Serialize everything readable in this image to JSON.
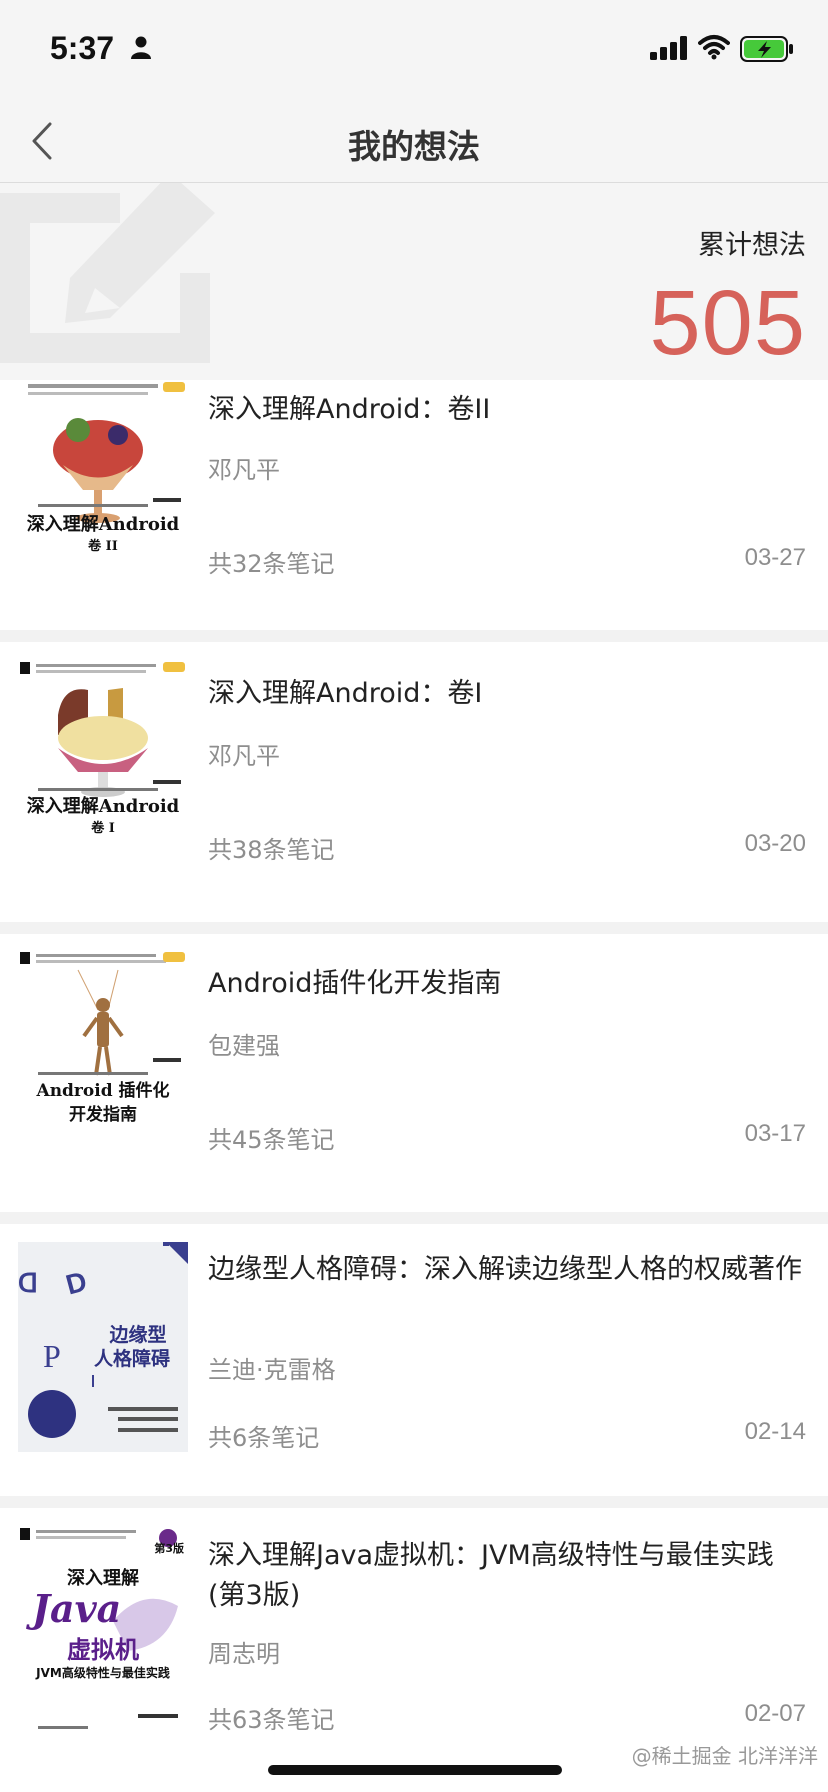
{
  "status_bar": {
    "time": "5:37"
  },
  "nav": {
    "title": "我的想法"
  },
  "summary": {
    "label": "累计想法",
    "count": "505"
  },
  "books": [
    {
      "title": "深入理解Android：卷II",
      "author": "邓凡平",
      "notes": "共32条笔记",
      "date": "03-27",
      "cover_title": "深入理解Android",
      "cover_subtitle": "卷 II"
    },
    {
      "title": "深入理解Android：卷I",
      "author": "邓凡平",
      "notes": "共38条笔记",
      "date": "03-20",
      "cover_title": "深入理解Android",
      "cover_subtitle": "卷 I"
    },
    {
      "title": "Android插件化开发指南",
      "author": "包建强",
      "notes": "共45条笔记",
      "date": "03-17",
      "cover_title": "Android 插件化",
      "cover_subtitle": "开发指南"
    },
    {
      "title": "边缘型人格障碍：深入解读边缘型人格的权威著作",
      "author": "兰迪·克雷格",
      "notes": "共6条笔记",
      "date": "02-14",
      "cover_title": "边缘型",
      "cover_subtitle": "人格障碍"
    },
    {
      "title": "深入理解Java虚拟机：JVM高级特性与最佳实践(第3版)",
      "author": "周志明",
      "notes": "共63条笔记",
      "date": "02-07",
      "cover_title": "深入理解",
      "cover_subtitle": "虚拟机",
      "cover_lang": "Java",
      "cover_tagline": "JVM高级特性与最佳实践",
      "cover_edition": "第3版"
    }
  ],
  "watermark": {
    "text": "@稀土掘金 北洋洋洋"
  },
  "colors": {
    "accent": "#d6625a",
    "muted": "#8e8e8e",
    "background": "#f5f5f5"
  }
}
